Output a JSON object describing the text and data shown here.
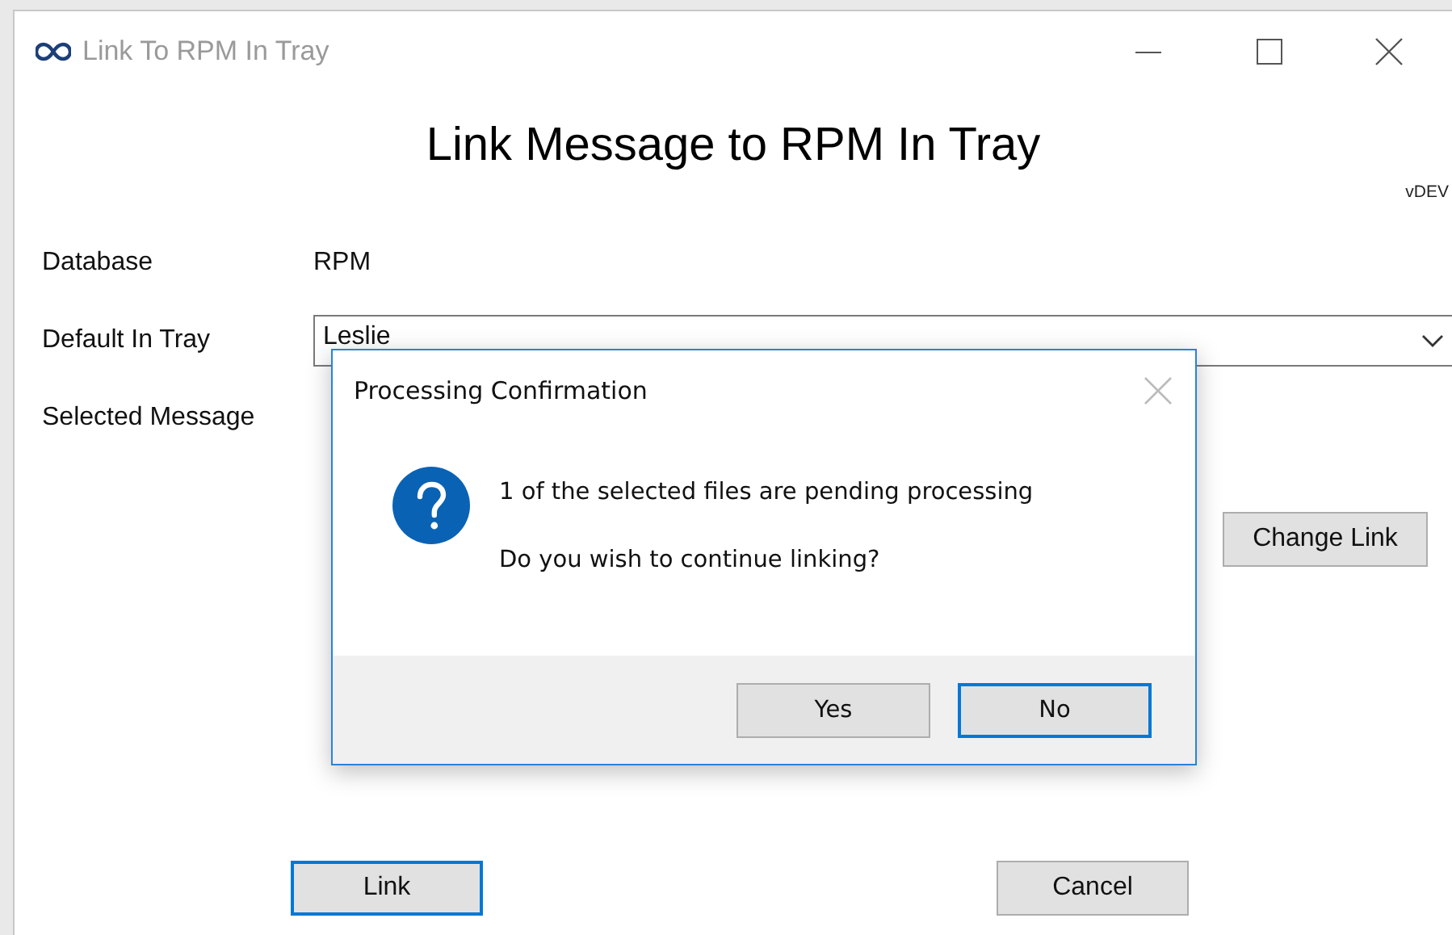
{
  "window": {
    "title": "Link To RPM In Tray"
  },
  "heading": "Link Message to RPM In Tray",
  "version": "vDEV",
  "fields": [
    {
      "label": "Database",
      "kind": "text",
      "value": "RPM"
    },
    {
      "label": "Default In Tray",
      "kind": "dropdown",
      "value": "Leslie"
    },
    {
      "label": "Selected Message",
      "kind": "empty"
    }
  ],
  "change_link_button": "Change Link",
  "buttons": [
    {
      "label": "Link",
      "default": true
    },
    {
      "label": "Cancel",
      "default": false
    }
  ],
  "dialog": {
    "title": "Processing Confirmation",
    "messages": [
      "1 of the selected files are pending processing",
      "Do you wish to continue linking?"
    ],
    "buttons": [
      {
        "label": "Yes",
        "focused": false
      },
      {
        "label": "No",
        "focused": true
      }
    ]
  }
}
